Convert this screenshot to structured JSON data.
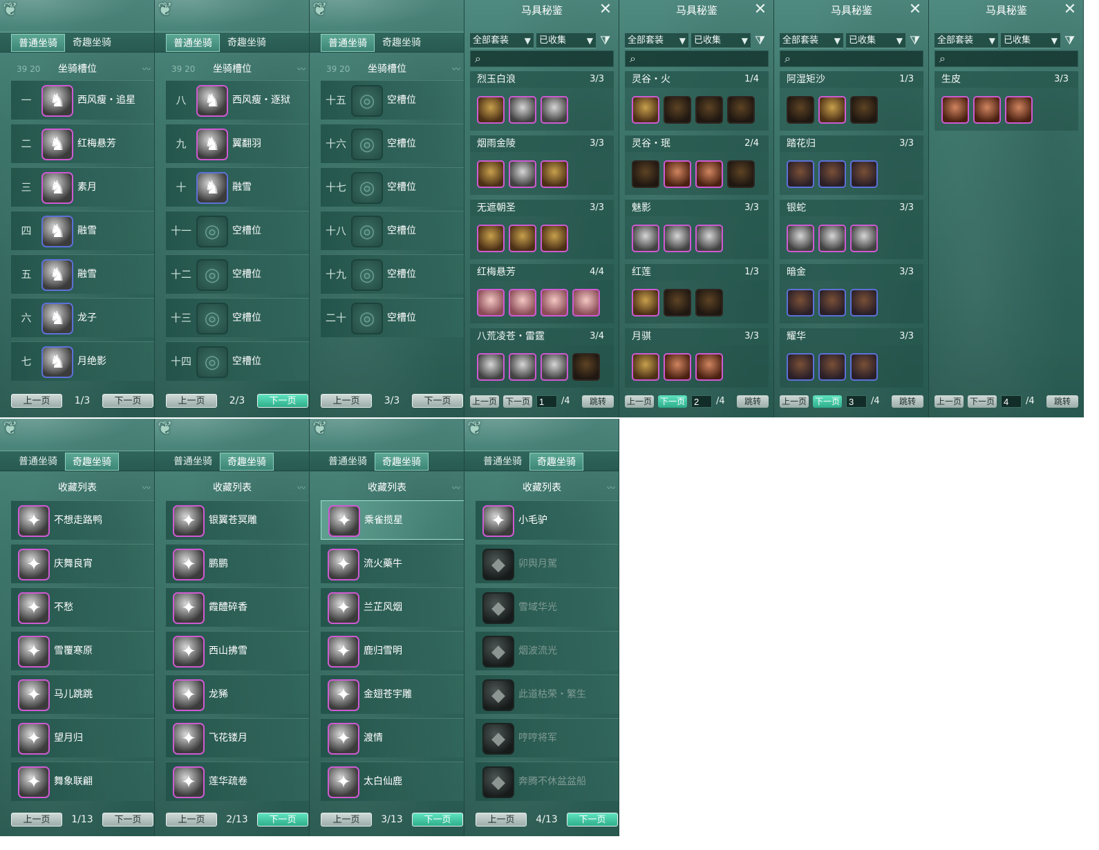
{
  "tabs": {
    "normal": "普通坐骑",
    "fun": "奇趣坐骑"
  },
  "slot_panels": [
    {
      "section_title": "坐骑槽位",
      "ghost_numbers": "39 20",
      "rows": [
        {
          "num": "一",
          "name": "西风瘦・追星",
          "empty": false,
          "frame": "pink"
        },
        {
          "num": "二",
          "name": "红梅悬芳",
          "empty": false,
          "frame": "pink"
        },
        {
          "num": "三",
          "name": "素月",
          "empty": false,
          "frame": "pink"
        },
        {
          "num": "四",
          "name": "融雪",
          "empty": false,
          "frame": "blue"
        },
        {
          "num": "五",
          "name": "融雪",
          "empty": false,
          "frame": "blue"
        },
        {
          "num": "六",
          "name": "龙子",
          "empty": false,
          "frame": "blue"
        },
        {
          "num": "七",
          "name": "月绝影",
          "empty": false,
          "frame": "blue"
        }
      ],
      "pager": {
        "prev": "上一页",
        "info": "1/3",
        "next": "下一页",
        "next_hl": false
      }
    },
    {
      "section_title": "坐骑槽位",
      "ghost_numbers": "39 20",
      "rows": [
        {
          "num": "八",
          "name": "西风瘦・逐狱",
          "empty": false,
          "frame": "pink"
        },
        {
          "num": "九",
          "name": "翼翻羽",
          "empty": false,
          "frame": "pink"
        },
        {
          "num": "十",
          "name": "融雪",
          "empty": false,
          "frame": "blue"
        },
        {
          "num": "十一",
          "name": "空槽位",
          "empty": true
        },
        {
          "num": "十二",
          "name": "空槽位",
          "empty": true
        },
        {
          "num": "十三",
          "name": "空槽位",
          "empty": true
        },
        {
          "num": "十四",
          "name": "空槽位",
          "empty": true
        }
      ],
      "pager": {
        "prev": "上一页",
        "info": "2/3",
        "next": "下一页",
        "next_hl": true
      }
    },
    {
      "section_title": "坐骑槽位",
      "ghost_numbers": "39 20",
      "rows": [
        {
          "num": "十五",
          "name": "空槽位",
          "empty": true
        },
        {
          "num": "十六",
          "name": "空槽位",
          "empty": true
        },
        {
          "num": "十七",
          "name": "空槽位",
          "empty": true
        },
        {
          "num": "十八",
          "name": "空槽位",
          "empty": true
        },
        {
          "num": "十九",
          "name": "空槽位",
          "empty": true
        },
        {
          "num": "二十",
          "name": "空槽位",
          "empty": true
        }
      ],
      "pager": {
        "prev": "上一页",
        "info": "3/3",
        "next": "下一页",
        "next_hl": false
      }
    }
  ],
  "saddle_panels": [
    {
      "title": "马具秘鉴",
      "filter_all": "全部套装",
      "filter_state": "已收集",
      "search_placeholder": "",
      "sets": [
        {
          "name": "烈玉白浪",
          "count": "3/3",
          "items": [
            "",
            "silver",
            "silver"
          ]
        },
        {
          "name": "烟雨金陵",
          "count": "3/3",
          "items": [
            "",
            "silver",
            ""
          ]
        },
        {
          "name": "无遮朝圣",
          "count": "3/3",
          "items": [
            "",
            "",
            ""
          ]
        },
        {
          "name": "红梅悬芳",
          "count": "4/4",
          "items": [
            "pink",
            "pink",
            "pink",
            "pink"
          ]
        },
        {
          "name": "八荒凌苍・雷霆",
          "count": "3/4",
          "items": [
            "silver",
            "silver",
            "silver",
            "locked"
          ]
        }
      ],
      "pager": {
        "prev": "上一页",
        "next": "下一页",
        "page": "1",
        "total": "/4",
        "jump": "跳转",
        "next_hl": false
      }
    },
    {
      "title": "马具秘鉴",
      "filter_all": "全部套装",
      "filter_state": "已收集",
      "search_placeholder": "",
      "sets": [
        {
          "name": "灵谷・火",
          "count": "1/4",
          "items": [
            "",
            "locked",
            "locked",
            "locked"
          ]
        },
        {
          "name": "灵谷・珉",
          "count": "2/4",
          "items": [
            "locked",
            "red",
            "red",
            "locked"
          ]
        },
        {
          "name": "魅影",
          "count": "3/3",
          "items": [
            "silver",
            "silver",
            "silver"
          ]
        },
        {
          "name": "红莲",
          "count": "1/3",
          "items": [
            "",
            "locked",
            "locked"
          ]
        },
        {
          "name": "月骐",
          "count": "3/3",
          "items": [
            "",
            "red",
            "red"
          ]
        }
      ],
      "pager": {
        "prev": "上一页",
        "next": "下一页",
        "page": "2",
        "total": "/4",
        "jump": "跳转",
        "next_hl": true
      }
    },
    {
      "title": "马具秘鉴",
      "filter_all": "全部套装",
      "filter_state": "已收集",
      "search_placeholder": "",
      "sets": [
        {
          "name": "阿湿矩沙",
          "count": "1/3",
          "items": [
            "locked",
            "",
            "locked"
          ]
        },
        {
          "name": "踏花归",
          "count": "3/3",
          "items": [
            "blue",
            "blue",
            "blue"
          ]
        },
        {
          "name": "银蛇",
          "count": "3/3",
          "items": [
            "silver",
            "silver",
            "silver"
          ]
        },
        {
          "name": "暗金",
          "count": "3/3",
          "items": [
            "blue",
            "blue",
            "blue"
          ]
        },
        {
          "name": "耀华",
          "count": "3/3",
          "items": [
            "blue",
            "blue",
            "blue"
          ]
        }
      ],
      "pager": {
        "prev": "上一页",
        "next": "下一页",
        "page": "3",
        "total": "/4",
        "jump": "跳转",
        "next_hl": true
      }
    },
    {
      "title": "马具秘鉴",
      "filter_all": "全部套装",
      "filter_state": "已收集",
      "search_placeholder": "",
      "sets": [
        {
          "name": "生皮",
          "count": "3/3",
          "items": [
            "red",
            "red",
            "red"
          ]
        }
      ],
      "pager": {
        "prev": "上一页",
        "next": "下一页",
        "page": "4",
        "total": "/4",
        "jump": "跳转",
        "next_hl": false
      }
    }
  ],
  "collection_panels": [
    {
      "section_title": "收藏列表",
      "rows": [
        {
          "name": "不想走路鸭",
          "owned": true
        },
        {
          "name": "庆舞良宵",
          "owned": true
        },
        {
          "name": "不愁",
          "owned": true
        },
        {
          "name": "雪覆寒原",
          "owned": true
        },
        {
          "name": "马儿跳跳",
          "owned": true
        },
        {
          "name": "望月归",
          "owned": true
        },
        {
          "name": "舞象联翩",
          "owned": true
        }
      ],
      "pager": {
        "prev": "上一页",
        "info": "1/13",
        "next": "下一页",
        "next_hl": false
      }
    },
    {
      "section_title": "收藏列表",
      "rows": [
        {
          "name": "银翼苍冥雕",
          "owned": true
        },
        {
          "name": "鹏鹏",
          "owned": true
        },
        {
          "name": "霞醴碎香",
          "owned": true
        },
        {
          "name": "西山拂雪",
          "owned": true
        },
        {
          "name": "龙豨",
          "owned": true
        },
        {
          "name": "飞花镂月",
          "owned": true
        },
        {
          "name": "莲华疏卷",
          "owned": true
        }
      ],
      "pager": {
        "prev": "上一页",
        "info": "2/13",
        "next": "下一页",
        "next_hl": true
      }
    },
    {
      "section_title": "收藏列表",
      "rows": [
        {
          "name": "乘雀揽星",
          "owned": true,
          "highlight": true
        },
        {
          "name": "流火藥牛",
          "owned": true
        },
        {
          "name": "兰芷风烟",
          "owned": true
        },
        {
          "name": "鹿归雪明",
          "owned": true
        },
        {
          "name": "金翅苍宇雕",
          "owned": true
        },
        {
          "name": "渡情",
          "owned": true
        },
        {
          "name": "太白仙鹿",
          "owned": true
        }
      ],
      "pager": {
        "prev": "上一页",
        "info": "3/13",
        "next": "下一页",
        "next_hl": true
      }
    },
    {
      "section_title": "收藏列表",
      "rows": [
        {
          "name": "小毛驴",
          "owned": true
        },
        {
          "name": "卯舆月駕",
          "owned": false
        },
        {
          "name": "雪域华光",
          "owned": false
        },
        {
          "name": "烟波流光",
          "owned": false
        },
        {
          "name": "此道枯荣・繁生",
          "owned": false
        },
        {
          "name": "哼哼将军",
          "owned": false
        },
        {
          "name": "奔腾不休盆盆船",
          "owned": false
        }
      ],
      "pager": {
        "prev": "上一页",
        "info": "4/13",
        "next": "下一页",
        "next_hl": true
      }
    }
  ],
  "colors": {
    "panel_bg": "#3b7469",
    "active_tab": "#5ca794",
    "pink_frame": "#cf5ad3",
    "blue_frame": "#5c71d8",
    "highlight_button": "#2fae8b"
  }
}
